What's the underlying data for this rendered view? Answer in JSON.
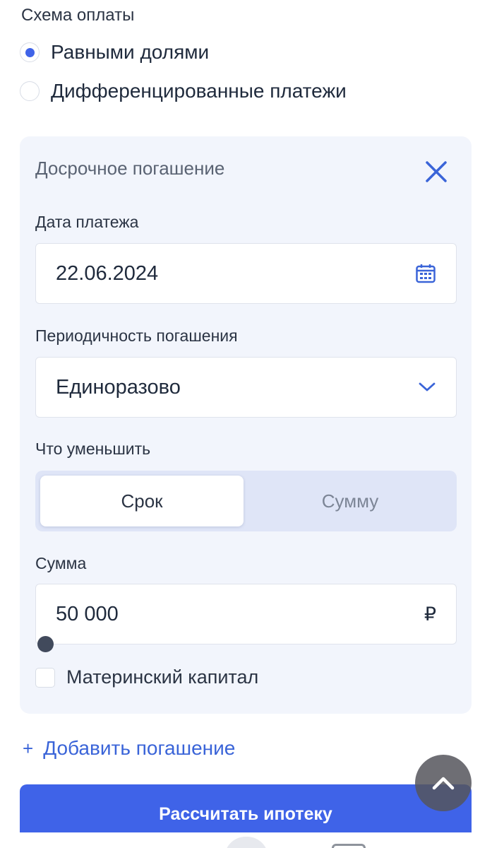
{
  "payment_scheme": {
    "label": "Схема оплаты",
    "options": [
      {
        "label": "Равными долями",
        "selected": true
      },
      {
        "label": "Дифференцированные платежи",
        "selected": false
      }
    ]
  },
  "early_repayment": {
    "title": "Досрочное погашение",
    "close_icon": "close-icon",
    "date": {
      "label": "Дата платежа",
      "value": "22.06.2024",
      "icon": "calendar-icon"
    },
    "frequency": {
      "label": "Периодичность погашения",
      "value": "Единоразово",
      "icon": "chevron-down-icon"
    },
    "reduce": {
      "label": "Что уменьшить",
      "options": [
        "Срок",
        "Сумму"
      ],
      "selected": "Срок"
    },
    "amount": {
      "label": "Сумма",
      "value": "50 000",
      "currency": "₽"
    },
    "maternity_capital": {
      "label": "Материнский капитал",
      "checked": false
    }
  },
  "add_repayment": {
    "icon": "+",
    "label": "Добавить погашение"
  },
  "calculate_button": {
    "label": "Рассчитать ипотеку"
  },
  "colors": {
    "accent": "#3f63e8",
    "link": "#3a64d8",
    "card_bg": "#f2f5fc",
    "segment_bg": "#dfe5f7"
  }
}
